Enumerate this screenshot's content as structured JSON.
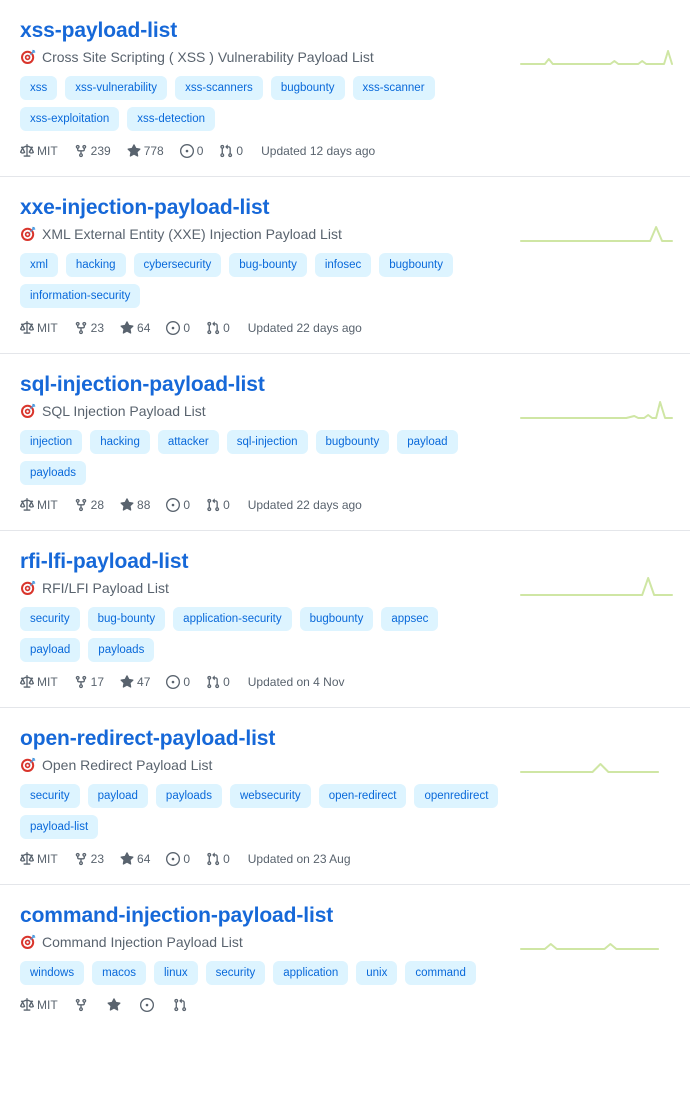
{
  "repositories": [
    {
      "name": "xss-payload-list",
      "description": "Cross Site Scripting ( XSS ) Vulnerability Payload List",
      "emoji": "dart-icon",
      "topics": [
        "xss",
        "xss-vulnerability",
        "xss-scanners",
        "bugbounty",
        "xss-scanner",
        "xss-exploitation",
        "xss-detection"
      ],
      "license": "MIT",
      "forks": "239",
      "stars": "778",
      "issues": "0",
      "pull_requests": "0",
      "updated": "Updated 12 days ago",
      "sparkline": "2,22 18,22 26,22 30,17 34,22 60,22 92,22 96,19 100,22 112,22 120,22 124,19 128,22 140,22 146,22 150,9 154,22"
    },
    {
      "name": "xxe-injection-payload-list",
      "description": "XML External Entity (XXE) Injection Payload List",
      "emoji": "dart-icon",
      "topics": [
        "xml",
        "hacking",
        "cybersecurity",
        "bug-bounty",
        "infosec",
        "bugbounty",
        "information-security"
      ],
      "license": "MIT",
      "forks": "23",
      "stars": "64",
      "issues": "0",
      "pull_requests": "0",
      "updated": "Updated 22 days ago",
      "sparkline": "2,22 100,22 124,22 132,22 138,8 144,22 154,22"
    },
    {
      "name": "sql-injection-payload-list",
      "description": "SQL Injection Payload List",
      "emoji": "dart-icon",
      "topics": [
        "injection",
        "hacking",
        "attacker",
        "sql-injection",
        "bugbounty",
        "payload",
        "payloads"
      ],
      "license": "MIT",
      "forks": "28",
      "stars": "88",
      "issues": "0",
      "pull_requests": "0",
      "updated": "Updated 22 days ago",
      "sparkline": "2,22 108,22 116,20 120,22 126,22 130,19 134,22 138,22 142,6 147,22 154,22"
    },
    {
      "name": "rfi-lfi-payload-list",
      "description": "RFI/LFI Payload List",
      "emoji": "dart-icon",
      "topics": [
        "security",
        "bug-bounty",
        "application-security",
        "bugbounty",
        "appsec",
        "payload",
        "payloads"
      ],
      "license": "MIT",
      "forks": "17",
      "stars": "47",
      "issues": "0",
      "pull_requests": "0",
      "updated": "Updated on 4 Nov",
      "sparkline": "2,22 112,22 124,22 130,5 136,22 154,22"
    },
    {
      "name": "open-redirect-payload-list",
      "description": "Open Redirect Payload List",
      "emoji": "dart-icon",
      "topics": [
        "security",
        "payload",
        "payloads",
        "websecurity",
        "open-redirect",
        "openredirect",
        "payload-list"
      ],
      "license": "MIT",
      "forks": "23",
      "stars": "64",
      "issues": "0",
      "pull_requests": "0",
      "updated": "Updated on 23 Aug",
      "sparkline": "2,22 74,22 82,14 90,22 132,22 140,22"
    },
    {
      "name": "command-injection-payload-list",
      "description": "Command Injection Payload List",
      "emoji": "dart-icon",
      "topics": [
        "windows",
        "macos",
        "linux",
        "security",
        "application",
        "unix",
        "command"
      ],
      "license": "MIT",
      "forks": "",
      "stars": "",
      "issues": "",
      "pull_requests": "",
      "updated": "",
      "sparkline": "2,22 26,22 32,17 38,22 86,22 92,17 98,22 140,22"
    }
  ],
  "icons": {
    "license": "law-icon",
    "forks": "repo-forked-icon",
    "stars": "star-icon",
    "issues": "issue-opened-icon",
    "pull_requests": "git-pull-request-icon",
    "sparkline": "sparkline-chart"
  },
  "colors": {
    "title_link": "#1668d8",
    "topic_bg": "#ddf4ff",
    "topic_text": "#0969da",
    "meta_text": "#59636e",
    "sparkline_line": "#cfe6a4",
    "divider": "#e4e6ea"
  }
}
